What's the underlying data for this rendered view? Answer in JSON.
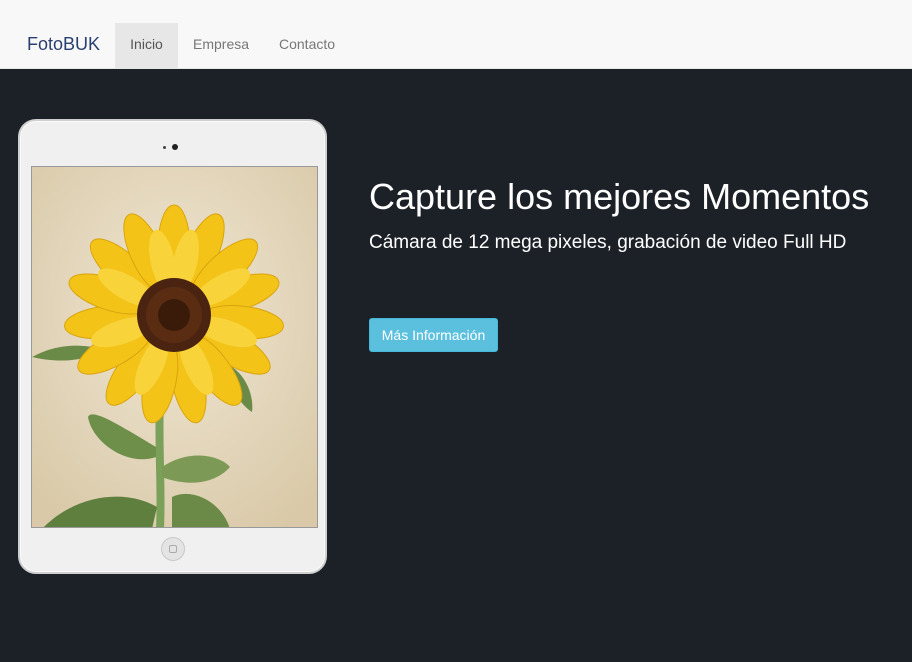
{
  "navbar": {
    "brand": "FotoBUK",
    "items": [
      {
        "label": "Inicio",
        "active": true
      },
      {
        "label": "Empresa",
        "active": false
      },
      {
        "label": "Contacto",
        "active": false
      }
    ]
  },
  "hero": {
    "headline": "Capture los mejores Momentos",
    "subheadline": "Cámara de 12 mega pixeles, grabación de video Full HD",
    "button_label": "Más Información",
    "image_subject": "sunflower-photo",
    "device": "tablet"
  },
  "colors": {
    "background": "#1c2128",
    "navbar": "#f8f8f8",
    "brand": "#2a3f6f",
    "accent_button": "#5bc0de",
    "active_nav": "#e7e7e7"
  }
}
